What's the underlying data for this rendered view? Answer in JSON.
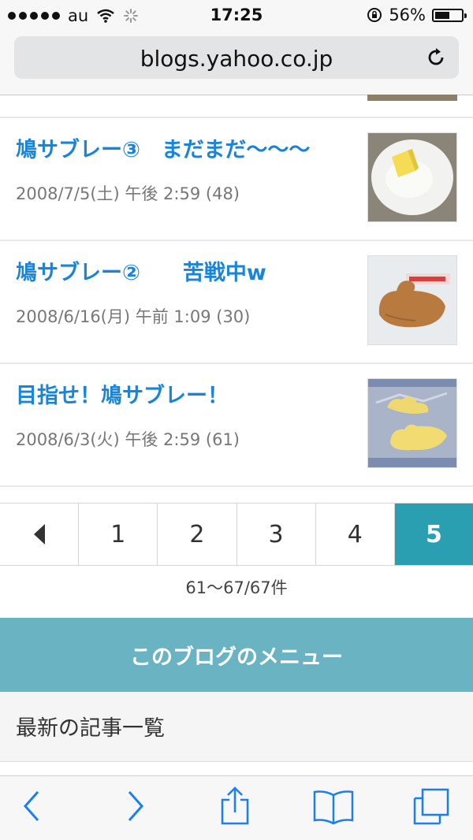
{
  "status": {
    "carrier": "au",
    "time": "17:25",
    "battery": "56%",
    "battery_level": 0.56
  },
  "browser": {
    "url": "blogs.yahoo.co.jp"
  },
  "articles": [
    {
      "title": "鳩サブレー③　まだまだ〜〜〜",
      "meta": "2008/7/5(土) 午後 2:59 (48)",
      "thumb_icon": "butter-sugar-photo"
    },
    {
      "title": "鳩サブレー②　　苦戦中w",
      "meta": "2008/6/16(月) 午前 1:09 (30)",
      "thumb_icon": "dove-cookie-photo"
    },
    {
      "title": "目指せ！鳩サブレー！",
      "meta": "2008/6/3(火) 午後 2:59 (61)",
      "thumb_icon": "dough-on-foil-photo"
    }
  ],
  "pagination": {
    "pages": [
      "1",
      "2",
      "3",
      "4",
      "5"
    ],
    "current": "5",
    "count_text": "61〜67/67件"
  },
  "menu": {
    "header": "このブログのメニュー",
    "items": [
      "最新の記事一覧"
    ]
  },
  "colors": {
    "link": "#1a84d8",
    "active_page": "#2a9fb2",
    "menu_header": "#69b3c2",
    "toolbar_icon": "#1a7ff0"
  }
}
